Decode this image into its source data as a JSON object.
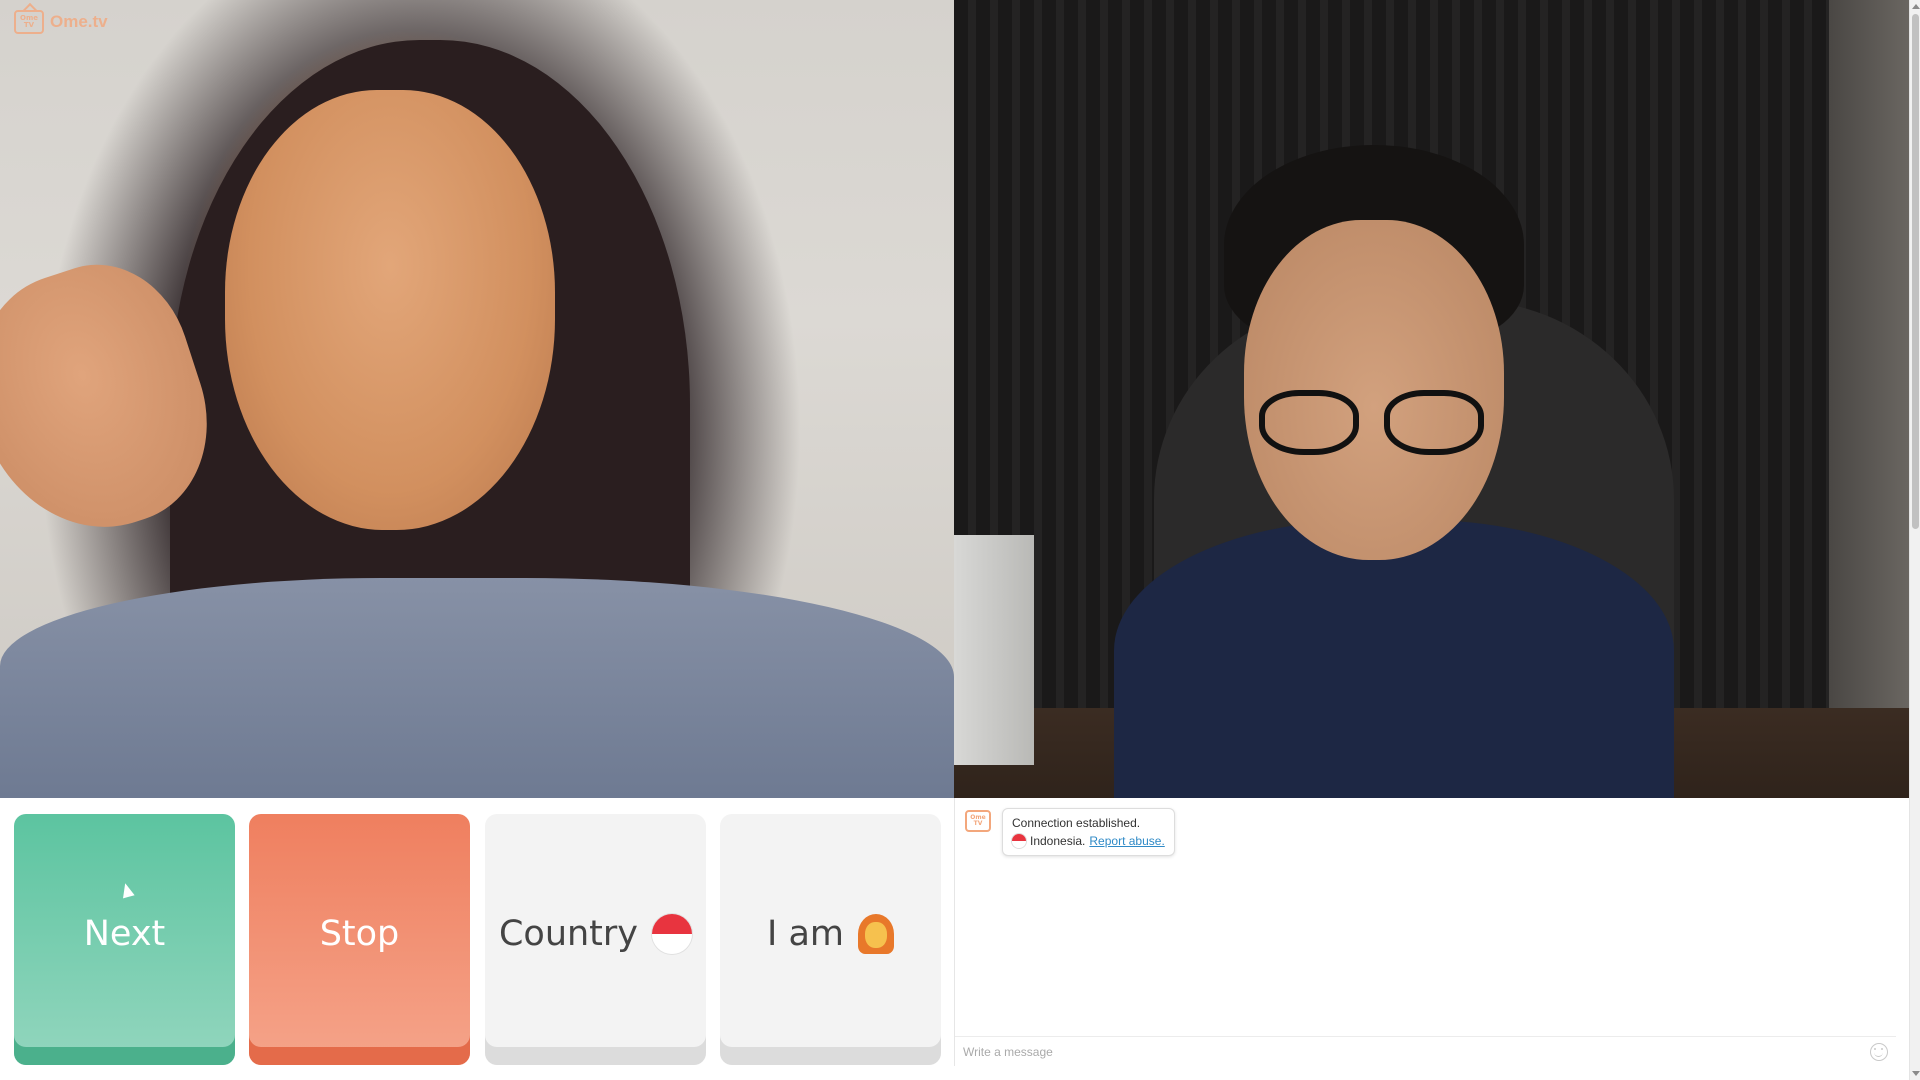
{
  "app": {
    "logo_text": "Ome.tv",
    "logo_icon_text": "Ome TV"
  },
  "controls": {
    "next_label": "Next",
    "stop_label": "Stop",
    "country_label": "Country",
    "iam_label": "I am",
    "country_flag_icon": "indonesia-flag-icon",
    "iam_icon": "woman-emoji-icon"
  },
  "chat": {
    "system_avatar_text": "Ome TV",
    "message_line1": "Connection established.",
    "country_name": "Indonesia.",
    "report_link": "Report abuse.",
    "input_placeholder": "Write a message",
    "input_value": ""
  },
  "colors": {
    "next": "#5cc4a0",
    "stop": "#ef7f5f",
    "neutral": "#f3f3f3",
    "brand": "#f3a77c",
    "link": "#2f8ac7"
  }
}
